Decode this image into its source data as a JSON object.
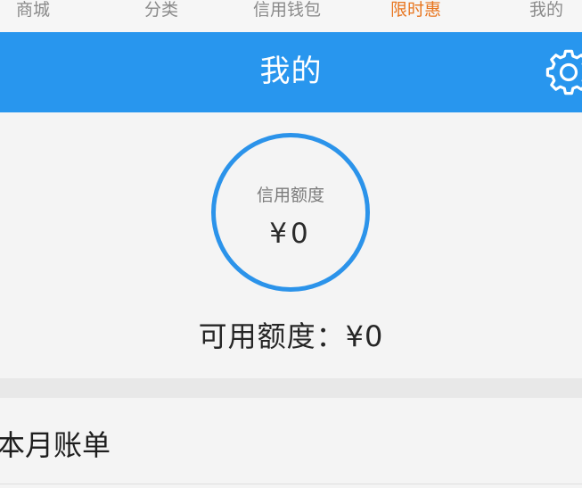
{
  "tabs": [
    {
      "label": "商城"
    },
    {
      "label": "分类"
    },
    {
      "label": "信用钱包"
    },
    {
      "label": "限时惠",
      "active": true
    },
    {
      "label": "我的"
    }
  ],
  "header": {
    "title": "我的",
    "settings_icon": "gear-icon"
  },
  "credit": {
    "limit_label": "信用额度",
    "limit_value": "¥0",
    "available_text": "可用额度：¥0"
  },
  "bill": {
    "label": "本月账单"
  },
  "colors": {
    "header_blue": "#2896ee",
    "ring_blue": "#2b93ea",
    "active_tab": "#e8751e"
  }
}
